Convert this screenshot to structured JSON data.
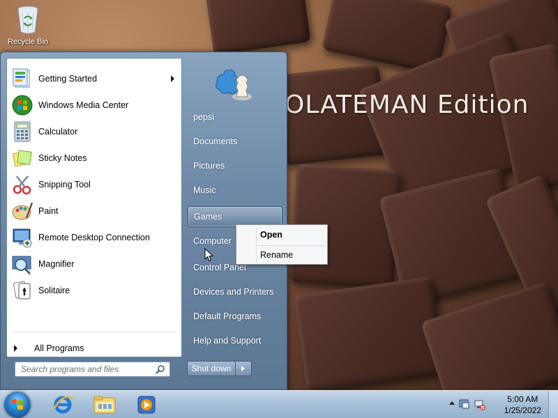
{
  "desktop": {
    "recycle_bin_label": "Recycle Bin",
    "wallpaper_text": "OLATEMAN Edition"
  },
  "start_menu": {
    "programs": [
      {
        "label": "Getting Started",
        "icon": "getting-started-icon",
        "has_submenu": true
      },
      {
        "label": "Windows Media Center",
        "icon": "media-center-icon",
        "has_submenu": false
      },
      {
        "label": "Calculator",
        "icon": "calculator-icon",
        "has_submenu": false
      },
      {
        "label": "Sticky Notes",
        "icon": "sticky-notes-icon",
        "has_submenu": false
      },
      {
        "label": "Snipping Tool",
        "icon": "snipping-tool-icon",
        "has_submenu": false
      },
      {
        "label": "Paint",
        "icon": "paint-icon",
        "has_submenu": false
      },
      {
        "label": "Remote Desktop Connection",
        "icon": "remote-desktop-icon",
        "has_submenu": false
      },
      {
        "label": "Magnifier",
        "icon": "magnifier-icon",
        "has_submenu": false
      },
      {
        "label": "Solitaire",
        "icon": "solitaire-icon",
        "has_submenu": false
      }
    ],
    "all_programs_label": "All Programs",
    "search_placeholder": "Search programs and files",
    "right_items": [
      {
        "label": "pepsi",
        "highlighted": false
      },
      {
        "label": "Documents",
        "highlighted": false
      },
      {
        "label": "Pictures",
        "highlighted": false
      },
      {
        "label": "Music",
        "highlighted": false
      },
      {
        "label": "Games",
        "highlighted": true
      },
      {
        "label": "Computer",
        "highlighted": false
      },
      {
        "label": "Control Panel",
        "highlighted": false
      },
      {
        "label": "Devices and Printers",
        "highlighted": false
      },
      {
        "label": "Default Programs",
        "highlighted": false
      },
      {
        "label": "Help and Support",
        "highlighted": false
      }
    ],
    "shutdown_label": "Shut down"
  },
  "context_menu": {
    "items": [
      {
        "label": "Open",
        "bold": true
      },
      {
        "label": "Rename",
        "bold": false
      }
    ]
  },
  "taskbar": {
    "pinned": [
      {
        "name": "internet-explorer-icon"
      },
      {
        "name": "windows-explorer-icon"
      },
      {
        "name": "media-player-icon"
      }
    ],
    "clock_time": "5:00 AM",
    "clock_date": "1/25/2022"
  }
}
